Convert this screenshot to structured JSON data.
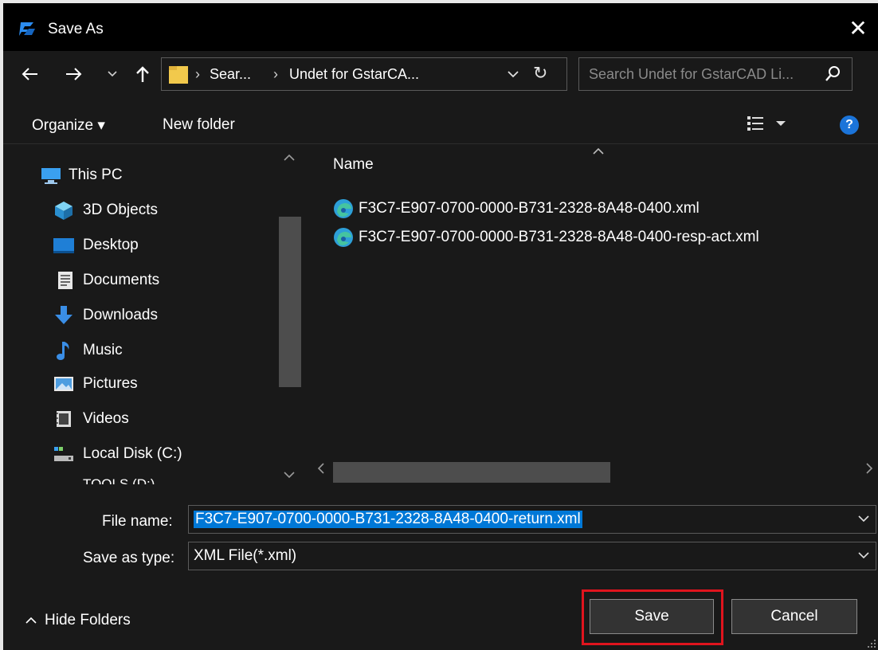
{
  "window": {
    "title": "Save As",
    "close_glyph": "✕",
    "app_icon": "gstarcad-logo-icon"
  },
  "nav": {
    "back_glyph": "←",
    "forward_glyph": "→",
    "recent_glyph": "˅",
    "up_glyph": "↑",
    "breadcrumb": [
      "Sear...",
      "Undet for GstarCA..."
    ],
    "breadcrumb_sep": "›",
    "dropdown_glyph": "˅",
    "refresh_glyph": "↻",
    "search_placeholder": "Search Undet for GstarCAD Li..."
  },
  "toolbar": {
    "organize_label": "Organize ▾",
    "new_folder_label": "New folder",
    "help_label": "?"
  },
  "sidebar": {
    "items": [
      {
        "label": "This PC",
        "icon": "this-pc-icon"
      },
      {
        "label": "3D Objects",
        "icon": "3d-objects-icon"
      },
      {
        "label": "Desktop",
        "icon": "desktop-icon"
      },
      {
        "label": "Documents",
        "icon": "documents-icon"
      },
      {
        "label": "Downloads",
        "icon": "downloads-icon"
      },
      {
        "label": "Music",
        "icon": "music-icon"
      },
      {
        "label": "Pictures",
        "icon": "pictures-icon"
      },
      {
        "label": "Videos",
        "icon": "videos-icon"
      },
      {
        "label": "Local Disk (C:)",
        "icon": "local-disk-icon"
      },
      {
        "label": "TOOLS (D:)",
        "icon": "drive-icon"
      }
    ]
  },
  "file_list": {
    "column_name": "Name",
    "files": [
      {
        "name": "F3C7-E907-0700-0000-B731-2328-8A48-0400.xml",
        "icon": "edge-xml-icon"
      },
      {
        "name": "F3C7-E907-0700-0000-B731-2328-8A48-0400-resp-act.xml",
        "icon": "edge-xml-icon"
      }
    ]
  },
  "form": {
    "file_name_label": "File name:",
    "file_name_value": "F3C7-E907-0700-0000-B731-2328-8A48-0400-return.xml",
    "save_type_label": "Save as type:",
    "save_type_value": "XML File(*.xml)"
  },
  "footer": {
    "hide_folders_label": "Hide Folders",
    "save_label": "Save",
    "cancel_label": "Cancel"
  },
  "colors": {
    "background": "#191919",
    "titlebar": "#000000",
    "accent": "#0078d7",
    "highlight_border": "#e0141e"
  }
}
